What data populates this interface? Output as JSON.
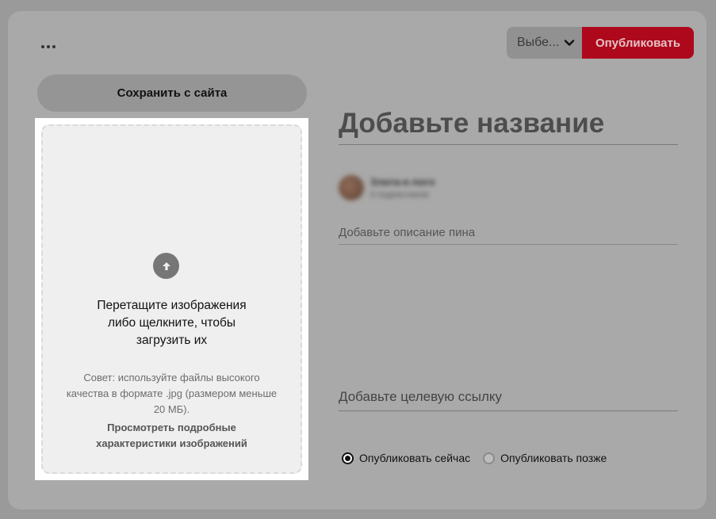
{
  "header": {
    "board_select_label": "Выбе...",
    "publish_label": "Опубликовать"
  },
  "left": {
    "save_from_site_label": "Сохранить с сайта",
    "dropzone": {
      "main_text": "Перетащите изображения либо щелкните, чтобы загрузить их",
      "tip_text": "Совет: используйте файлы высокого качества в формате .jpg (размером меньше 20 МБ).",
      "specs_link": "Просмотреть подробные характеристики изображений"
    }
  },
  "form": {
    "title_placeholder": "Добавьте название",
    "user": {
      "name": "Злата-к-лого",
      "subtitle": "0 подписчиков"
    },
    "description_placeholder": "Добавьте описание пина",
    "link_placeholder": "Добавьте целевую ссылку",
    "publish_options": [
      {
        "label": "Опубликовать сейчас",
        "checked": true
      },
      {
        "label": "Опубликовать позже",
        "checked": false
      }
    ]
  },
  "colors": {
    "publish_red": "#ad081b",
    "overlay_gray": "#a9a9a9",
    "panel_white": "#ffffff"
  },
  "icons": [
    "more-icon",
    "chevron-down-icon",
    "upload-arrow-icon"
  ]
}
